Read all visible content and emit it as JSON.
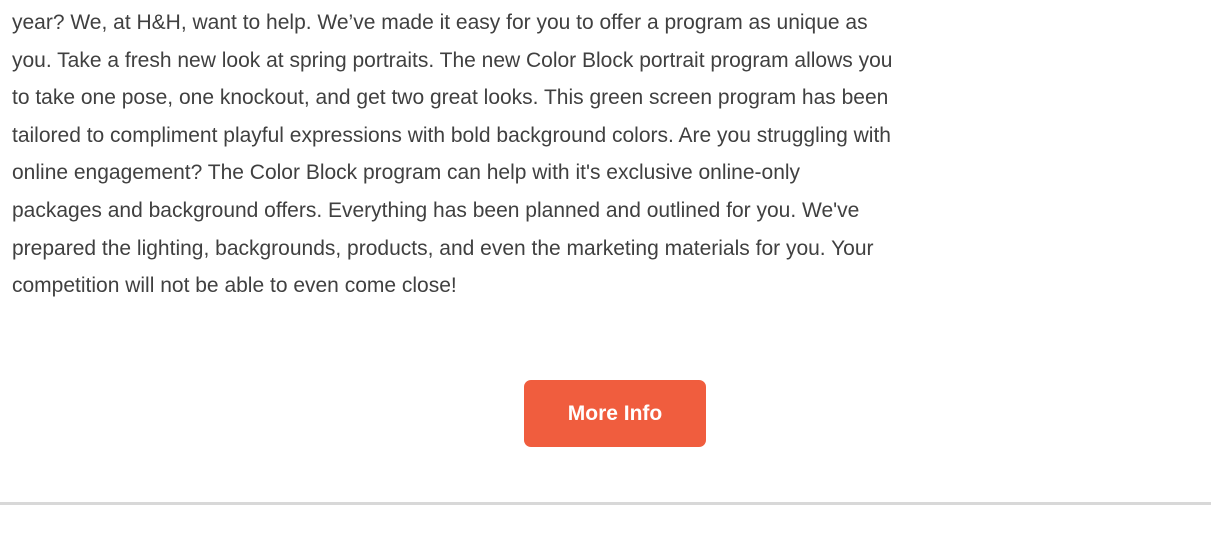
{
  "article": {
    "lines": [
      "year? We, at H&H, want to help. We’ve made it easy for you to offer a program as unique as",
      "you. Take a fresh new look at spring portraits. The new Color Block portrait program allows you",
      "to take one pose, one knockout, and get two great looks. This green screen program has been",
      "tailored to compliment playful expressions with bold background colors. Are you struggling with",
      "online engagement? The Color Block program can help with it's exclusive online-only",
      "packages and background offers. Everything has been planned and outlined for you. We've",
      "prepared the lighting, backgrounds, products, and even the marketing materials for you. Your",
      "competition will not be able to even come close!"
    ]
  },
  "cta": {
    "label": "More Info",
    "color": "#f05d3e",
    "text_color": "#ffffff"
  },
  "divider": {
    "color": "#d8d8d8"
  }
}
